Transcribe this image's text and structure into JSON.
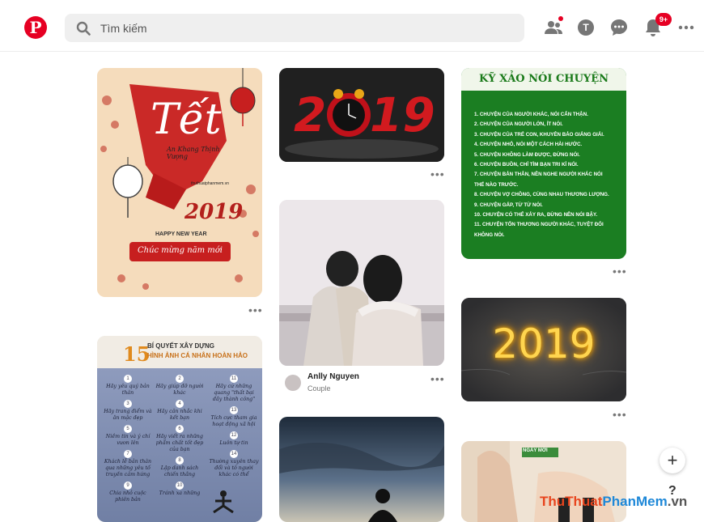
{
  "header": {
    "search_placeholder": "Tìm kiếm",
    "avatar_initial": "T",
    "notification_badge": "9+"
  },
  "pins": {
    "tet": {
      "title": "Tết",
      "subtitle": "An Khang Thịnh Vượng",
      "site": "thuthuatphanmem.vn",
      "year": "2019",
      "greeting": "HAPPY NEW YEAR",
      "banner": "Chúc mừng năm mới"
    },
    "clock2019": {
      "left": "2",
      "right": "19"
    },
    "couple": {
      "user": "Anlly Nguyen",
      "board": "Couple"
    },
    "kyxao": {
      "title": "KỸ XẢO NÓI CHUYỆN",
      "items": [
        "1. CHUYỆN CỦA NGƯỜI KHÁC, NÓI CẨN THẬN.",
        "2. CHUYỆN CỦA NGƯỜI LỚN, ÍT NÓI.",
        "3. CHUYỆN CỦA TRẺ CON, KHUYÊN BẢO GIẢNG GIẢI.",
        "4. CHUYỆN NHỎ, NÓI MỘT CÁCH HÀI HƯỚC.",
        "5. CHUYỆN KHÔNG LÀM ĐƯỢC, ĐỪNG NÓI.",
        "6. CHUYỆN BUỒN, CHỈ TÌM BẠN TRI KỈ NÓI.",
        "7. CHUYỆN BẢN THÂN, NÊN NGHE NGƯỜI KHÁC NÓI",
        "THẾ NÀO TRƯỚC.",
        "8. CHUYỆN VỢ CHỒNG, CÙNG NHAU THƯƠNG LƯỢNG.",
        "9. CHUYỆN GẤP, TỪ TỪ NÓI.",
        "10. CHUYỆN CÓ THỂ XẢY RA, ĐỪNG NÊN NÓI BẬY.",
        "11. CHUYỆN TỔN THƯƠNG NGƯỜI KHÁC, TUYỆT ĐỐI",
        "KHÔNG NÓI."
      ]
    },
    "neon": {
      "text": "2019"
    },
    "quyet": {
      "number": "15",
      "line1": "BÍ QUYẾT XÂY DỰNG",
      "line2": "HÌNH ẢNH CÁ NHÂN HOÀN HẢO",
      "col1": [
        [
          "1",
          "Hãy yêu quý bản thân"
        ],
        [
          "3",
          "Hãy trang điểm và ăn mặc đẹp"
        ],
        [
          "5",
          "Niềm tin và ý chí vươn lên"
        ],
        [
          "7",
          "Khách lễ bản thân qua những yêu tố truyền cảm hứng"
        ],
        [
          "9",
          "Chia nhỏ cuộc phiên bản"
        ]
      ],
      "col2": [
        [
          "2",
          "Hãy giúp đỡ người khác"
        ],
        [
          "4",
          "Hãy cân nhắc khi kết bạn"
        ],
        [
          "6",
          "Hãy viết ra những phẩm chất tốt đẹp của bạn"
        ],
        [
          "8",
          "Lập danh sách chiến thắng"
        ],
        [
          "10",
          "Tránh xa những"
        ]
      ],
      "col3": [
        [
          "11",
          "Hãy cứ những quang \"thất bại đầy thành công\""
        ],
        [
          "13",
          "Tích cực tham gia hoạt động xã hội"
        ],
        [
          "12",
          "Luôn tự tin"
        ],
        [
          "14",
          "Thường xuyên thay đổi và tô người khác có thể"
        ]
      ]
    },
    "tag": "NGÀY MỚI"
  },
  "footer": {
    "fab_label": "+",
    "help_label": "?",
    "more_label": "•••",
    "watermark_a": "ThuThuat",
    "watermark_b": "PhanMem",
    "watermark_c": ".vn"
  },
  "colors": {
    "brand": "#e60023",
    "green": "#1a7a1a"
  }
}
